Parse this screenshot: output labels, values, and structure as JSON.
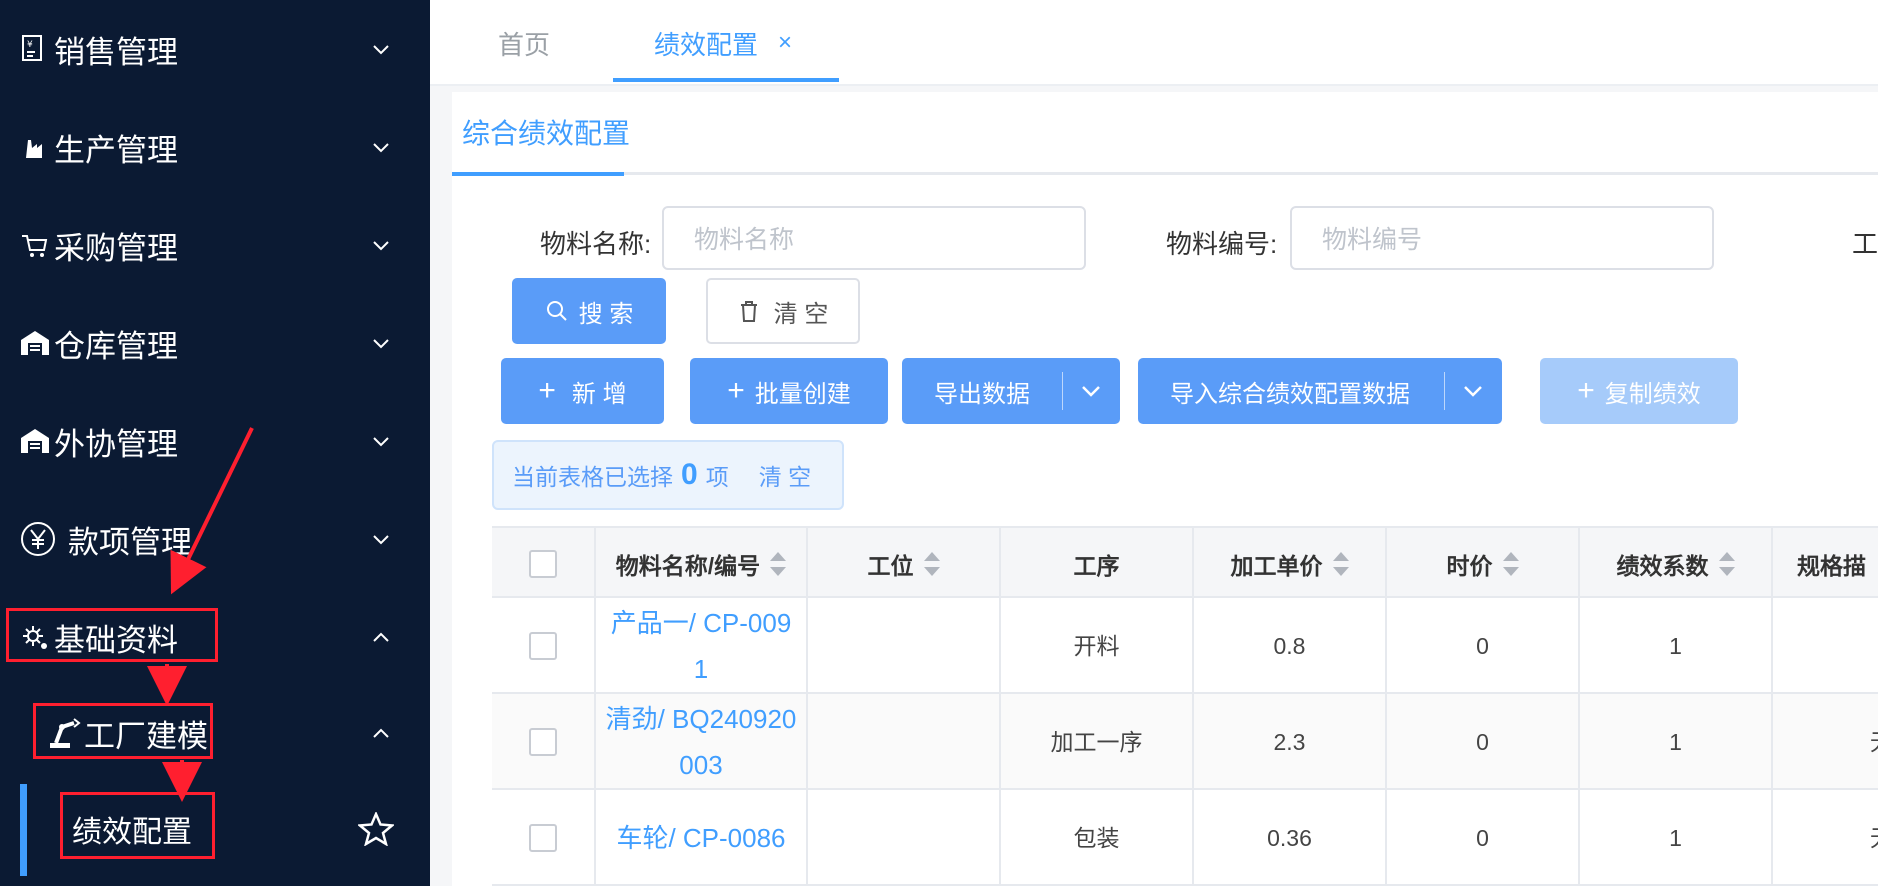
{
  "sidebar": {
    "items": [
      {
        "label": "销售管理",
        "icon": "sales-icon"
      },
      {
        "label": "生产管理",
        "icon": "factory-icon"
      },
      {
        "label": "采购管理",
        "icon": "cart-icon"
      },
      {
        "label": "仓库管理",
        "icon": "warehouse-icon"
      },
      {
        "label": "外协管理",
        "icon": "outsource-icon"
      },
      {
        "label": "款项管理",
        "icon": "yen-icon"
      },
      {
        "label": "基础资料",
        "icon": "gear-icon"
      }
    ],
    "sub_item": {
      "label": "工厂建模",
      "icon": "robot-arm-icon"
    },
    "leaf_item": {
      "label": "绩效配置",
      "icon": "star-icon"
    }
  },
  "tabs": [
    {
      "label": "首页"
    },
    {
      "label": "绩效配置",
      "close": "×"
    }
  ],
  "card": {
    "title": "综合绩效配置"
  },
  "filters": {
    "material_name_label": "物料名称:",
    "material_name_placeholder": "物料名称",
    "material_code_label": "物料编号:",
    "material_code_placeholder": "物料编号",
    "third_label_partial": "工"
  },
  "buttons": {
    "search": "搜 索",
    "clear": "清 空",
    "add": "新 增",
    "batch_create": "批量创建",
    "export": "导出数据",
    "import": "导入综合绩效配置数据",
    "copy": "复制绩效"
  },
  "selection": {
    "prefix": "当前表格已选择",
    "count": "0",
    "suffix": "项",
    "clear": "清 空"
  },
  "table": {
    "headers": [
      "物料名称/编号",
      "工位",
      "工序",
      "加工单价",
      "时价",
      "绩效系数",
      "规格描"
    ],
    "rows": [
      {
        "name_line1": "产品一/ CP-009",
        "name_line2": "1",
        "station": "",
        "process": "开料",
        "unit_price": "0.8",
        "hour_price": "0",
        "coef": "1",
        "spec": ""
      },
      {
        "name_line1": "清劲/ BQ240920",
        "name_line2": "003",
        "station": "",
        "process": "加工一序",
        "unit_price": "2.3",
        "hour_price": "0",
        "coef": "1",
        "spec": "无"
      },
      {
        "name_line1": "车轮/ CP-0086",
        "name_line2": "",
        "station": "",
        "process": "包装",
        "unit_price": "0.36",
        "hour_price": "0",
        "coef": "1",
        "spec": "无"
      }
    ]
  },
  "colors": {
    "sidebar_bg": "#0b1a33",
    "accent": "#409eff",
    "annotation": "#ff1f2f"
  }
}
